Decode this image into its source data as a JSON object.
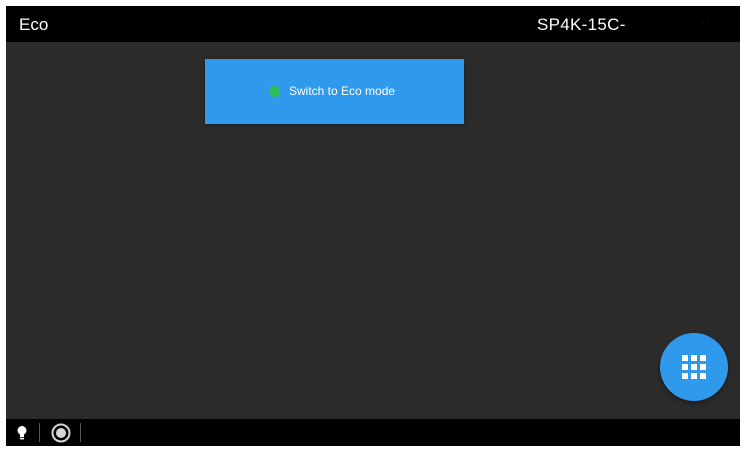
{
  "header": {
    "title": "Eco",
    "device_name": "SP4K-15C-",
    "faint_text": "· ·"
  },
  "main": {
    "eco_button": {
      "label": "Switch to Eco mode",
      "status_color": "#2ebd59"
    },
    "fab": {
      "icon": "grid-menu-icon"
    }
  },
  "footer": {
    "icons": [
      "lightbulb-icon",
      "record-icon"
    ]
  },
  "colors": {
    "accent": "#2f99ec",
    "background": "#2b2b2b",
    "bar": "#000000",
    "status_on": "#2ebd59"
  }
}
